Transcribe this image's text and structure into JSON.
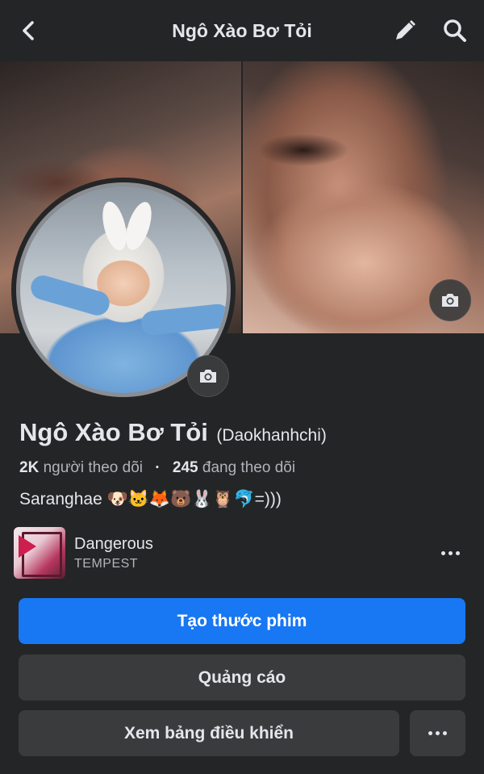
{
  "header": {
    "title": "Ngô Xào Bơ Tỏi"
  },
  "profile": {
    "name": "Ngô Xào Bơ Tỏi",
    "alternate_name": "(Daokhanhchi)",
    "followers_count": "2K",
    "followers_label": "người theo dõi",
    "separator": "·",
    "following_count": "245",
    "following_label": "đang theo dõi",
    "bio": "Saranghae 🐶🐱🦊🐻🐰🦉🐬=)))"
  },
  "music": {
    "song": "Dangerous",
    "artist": "TEMPEST"
  },
  "buttons": {
    "create_reel": "Tạo thước phim",
    "ads": "Quảng cáo",
    "dashboard": "Xem bảng điều khiển"
  },
  "icons": {
    "back": "chevron-left-icon",
    "edit": "pencil-icon",
    "search": "search-icon",
    "camera": "camera-icon",
    "more": "more-horizontal-icon"
  },
  "colors": {
    "background": "#242526",
    "primary_button": "#1877f2",
    "secondary_button": "#3a3b3c",
    "text": "#e4e6eb",
    "secondary_text": "#b0b3b8"
  }
}
